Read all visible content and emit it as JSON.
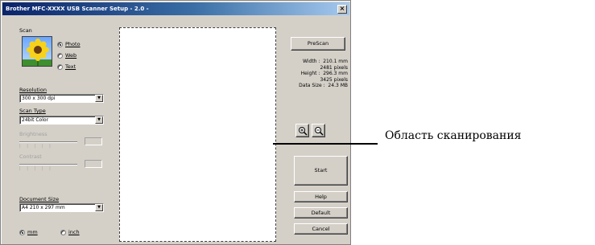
{
  "window": {
    "title": "Brother MFC-XXXX USB Scanner Setup - 2.0 -",
    "close_label": "×"
  },
  "scan": {
    "label": "Scan",
    "options": [
      "Photo",
      "Web",
      "Text"
    ],
    "selected": "Photo"
  },
  "resolution": {
    "label": "Resolution",
    "value": "300 x 300 dpi"
  },
  "scan_type": {
    "label": "Scan Type",
    "value": "24bit Color"
  },
  "brightness": {
    "label": "Brightness",
    "ticks": "|  |  |  |  |"
  },
  "contrast": {
    "label": "Contrast",
    "ticks": "|  |  |  |  |"
  },
  "document_size": {
    "label": "Document Size",
    "value": "A4 210 x 297 mm"
  },
  "units": {
    "options": [
      "mm",
      "inch"
    ],
    "selected": "mm"
  },
  "right_panel": {
    "prescan_label": "PreScan",
    "info": "Width :  210.1 mm\n2481 pixels\nHeight :  296.3 mm\n3425 pixels\nData Size :  24.3 MB",
    "start_label": "Start",
    "help_label": "Help",
    "default_label": "Default",
    "cancel_label": "Cancel"
  },
  "callout": {
    "label": "Область сканирования"
  },
  "icons": {
    "sunflower": "sunflower-photo-icon",
    "zoom_in": "zoom-in-icon",
    "zoom_out": "zoom-out-icon"
  },
  "colors": {
    "titlebar": "#0a246a",
    "window": "#d4d0c8",
    "callout": "#000000"
  }
}
